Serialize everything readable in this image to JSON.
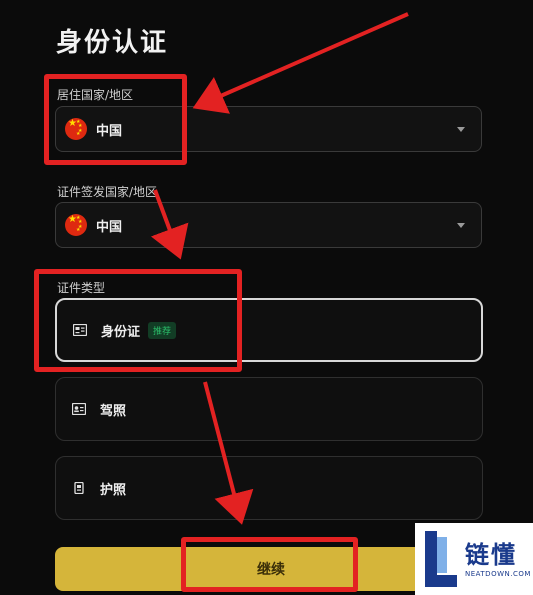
{
  "page": {
    "title": "身份认证"
  },
  "residence": {
    "label": "居住国家/地区",
    "value": "中国",
    "flag_icon": "china-flag-icon"
  },
  "issuing": {
    "label": "证件签发国家/地区",
    "value": "中国",
    "flag_icon": "china-flag-icon"
  },
  "doc_type": {
    "label": "证件类型",
    "options": [
      {
        "label": "身份证",
        "badge": "推荐",
        "icon": "id-card-icon",
        "selected": true
      },
      {
        "label": "驾照",
        "icon": "driver-license-icon",
        "selected": false
      },
      {
        "label": "护照",
        "icon": "passport-icon",
        "selected": false
      }
    ]
  },
  "continue_button": {
    "label": "继续"
  },
  "watermark": {
    "title": "链懂",
    "subtitle": "NEATDOWN.COM",
    "logo_letter": "L"
  },
  "colors": {
    "background": "#0b0b0b",
    "button": "#d5b53a",
    "annotation_red": "#e32222",
    "badge_green": "#2bbf6a"
  }
}
